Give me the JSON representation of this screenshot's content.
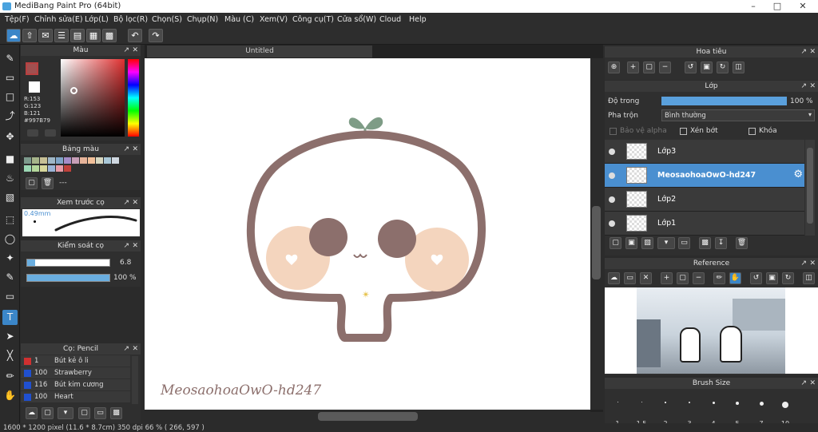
{
  "window": {
    "title": "MediBang Paint Pro (64bit)"
  },
  "menu": [
    "Tệp(F)",
    "Chỉnh sửa(E)",
    "Lớp(L)",
    "Bộ lọc(R)",
    "Chọn(S)",
    "Chụp(N)",
    "Màu (C)",
    "Xem(V)",
    "Công cụ(T)",
    "Cửa sổ(W)",
    "Cloud",
    "Help"
  ],
  "color_panel": {
    "title": "Màu",
    "r": "R:153",
    "g": "G:123",
    "b": "B:121",
    "hex": "#997B79",
    "fg_color": "#a05050",
    "bg_color": "#ffffff"
  },
  "palette_panel": {
    "title": "Bảng màu",
    "more": "---",
    "colors": [
      "#7d9a8c",
      "#a6b48a",
      "#c7c096",
      "#9fb7c7",
      "#7fa4c7",
      "#a58cc7",
      "#c79fb7",
      "#e7b49a",
      "#f2c09a",
      "#d7d7c0",
      "#a9c7d7",
      "#cfd7e0",
      "#9bd7b4",
      "#b4d79b",
      "#d7d79b",
      "#9bb4d7",
      "#e79ba7",
      "#c0413b"
    ]
  },
  "brush_preview": {
    "title": "Xem trước cọ",
    "size": "0.49mm"
  },
  "brush_control": {
    "title": "Kiểm soát cọ",
    "size_value": "6.8",
    "opacity_value": "100 %",
    "size_fraction": 0.1,
    "opacity_fraction": 1.0
  },
  "brush_list": {
    "title": "Cọ: Pencil",
    "items": [
      {
        "color": "#d03030",
        "size": "1",
        "name": "Bút kẻ ô li"
      },
      {
        "color": "#2050d0",
        "size": "100",
        "name": "Strawberry"
      },
      {
        "color": "#2050d0",
        "size": "116",
        "name": "Bút kim cương"
      },
      {
        "color": "#2050d0",
        "size": "100",
        "name": "Heart"
      }
    ]
  },
  "document": {
    "tab": "Untitled",
    "watermark": "MeosaohoaOwO-hd247"
  },
  "navigator": {
    "title": "Hoa tiêu"
  },
  "layer_panel": {
    "title": "Lớp",
    "opacity_label": "Độ trong",
    "opacity_value": "100 %",
    "opacity_fraction": 1.0,
    "blend_label": "Pha trộn",
    "blend_value": "Bình thường",
    "protect_alpha": "Bảo vệ alpha",
    "clipping": "Xén bớt",
    "lock": "Khóa",
    "layers": [
      {
        "name": "Lớp3",
        "selected": false
      },
      {
        "name": "MeosaohoaOwO-hd247",
        "selected": true
      },
      {
        "name": "Lớp2",
        "selected": false
      },
      {
        "name": "Lớp1",
        "selected": false
      }
    ]
  },
  "reference_panel": {
    "title": "Reference"
  },
  "brush_size_panel": {
    "title": "Brush Size",
    "sizes": [
      "1",
      "1.5",
      "2",
      "3",
      "4",
      "5",
      "7",
      "10"
    ]
  },
  "statusbar": {
    "text": "1600 * 1200 pixel   (11.6 * 8.7cm)   350 dpi   66 %   ( 266, 597 )"
  },
  "colors": {
    "accent": "#3b86c8",
    "selected_layer": "#4a8fd0",
    "stroke": "#8c6f6c",
    "cheek": "#f4d5be",
    "eye": "#8c6f6c",
    "sprout": "#7e9c86"
  }
}
